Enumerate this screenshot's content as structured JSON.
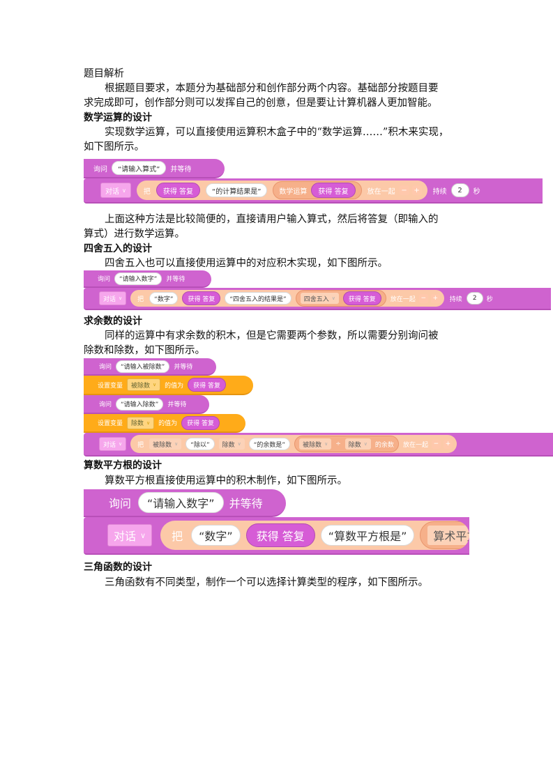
{
  "text": {
    "title": "题目解析",
    "p1a": "根据题目要求，本题分为基础部分和创作部分两个内容。基础部分按题目要",
    "p1b": "求完成即可，创作部分则可以发挥自己的创意，但是要让计算机器人更加智能。",
    "h1": "数学运算的设计",
    "p2a": "实现数学运算，可以直接使用运算积木盒子中的“数学运算……”积木来实现，",
    "p2b": "如下图所示。",
    "p3a": "上面这种方法是比较简便的，直接请用户输入算式，然后将答复（即输入的",
    "p3b": "算式）进行数学运算。",
    "h2": "四舍五入的设计",
    "p4": "四舍五入也可以直接使用运算中的对应积木实现，如下图所示。",
    "h3": "求余数的设计",
    "p5a": "同样的运算中有求余数的积木，但是它需要两个参数，所以需要分别询问被",
    "p5b": "除数和除数，如下图所示。",
    "h4": "算数平方根的设计",
    "p6": "算数平方根直接使用运算中的积木制作，如下图所示。",
    "h5": "三角函数的设计",
    "p7": "三角函数有不同类型，制作一个可以选择计算类型的程序，如下图所示。"
  },
  "fig1": {
    "ask": "询问",
    "ask_prompt": "“请输入算式”",
    "and_wait": "并等待",
    "say": "对话",
    "ba": "把",
    "answer": "获得 答复",
    "result_text": "“的计算结果是”",
    "math_op": "数学运算",
    "answer2": "获得 答复",
    "join": "放在一起",
    "minus": "−",
    "plus": "+",
    "for": "持续",
    "secs_value": "2",
    "secs": "秒"
  },
  "fig2": {
    "ask": "询问",
    "ask_prompt": "“请输入数字”",
    "and_wait": "并等待",
    "say": "对话",
    "ba": "把",
    "num_text": "“数字”",
    "answer": "获得 答复",
    "result_text": "“四舍五入的结果是”",
    "round_op": "四舍五入",
    "answer2": "获得 答复",
    "join": "放在一起",
    "minus": "−",
    "plus": "+",
    "for": "持续",
    "secs_value": "2",
    "secs": "秒"
  },
  "fig3": {
    "ask1": "询问",
    "ask1_prompt": "“请输入被除数”",
    "and_wait1": "并等待",
    "set1": "设置变量",
    "set1_var": "被除数",
    "set1_to": "的值为",
    "set1_answer": "获得 答复",
    "ask2": "询问",
    "ask2_prompt": "“请输入除数”",
    "and_wait2": "并等待",
    "set2": "设置变量",
    "set2_var": "除数",
    "set2_to": "的值为",
    "set2_answer": "获得 答复",
    "say": "对话",
    "ba": "把",
    "v1": "被除数",
    "t1": "“除以”",
    "v2": "除数",
    "t2": "“的余数是”",
    "mod_a": "被除数",
    "mod_sym": "÷",
    "mod_b": "除数",
    "mod_label": "的余数",
    "join": "放在一起",
    "minus": "−",
    "plus": "+"
  },
  "fig4": {
    "ask": "询问",
    "ask_prompt": "“请输入数字”",
    "and_wait": "并等待",
    "say": "对话",
    "ba": "把",
    "num_text": "“数字”",
    "answer": "获得 答复",
    "result_text": "“算数平方根是”",
    "sqrt_op": "算术平方根"
  },
  "colors": {
    "looks": "#cf63cf",
    "variables": "#ffab19",
    "operators_bg": "#fcc9a8"
  }
}
